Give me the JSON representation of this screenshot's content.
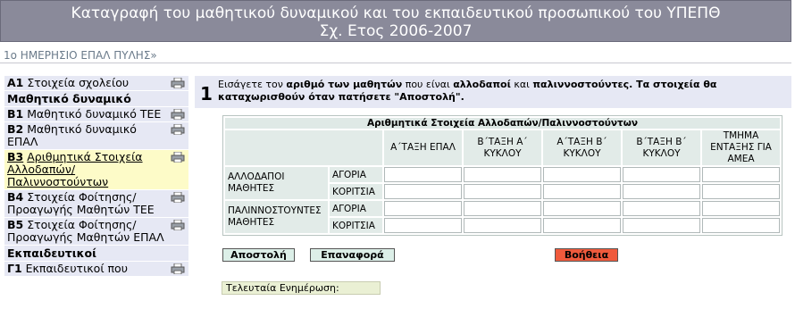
{
  "header": {
    "title_line1": "Καταγραφή του μαθητικού δυναμικού και του εκπαιδευτικού προσωπικού του ΥΠΕΠΘ",
    "title_line2": "Σχ. Ετος 2006-2007"
  },
  "school_name": "1ο ΗΜΕΡΗΣΙΟ ΕΠΑΛ ΠΥΛΗΣ»",
  "sidebar": {
    "items": [
      {
        "code": "A1",
        "label": "Στοιχεία σχολείου",
        "printer": true
      },
      {
        "heading": "Μαθητικό δυναμικό"
      },
      {
        "code": "B1",
        "label": "Μαθητικό δυναμικό ΤΕΕ",
        "printer": true
      },
      {
        "code": "B2",
        "label": "Μαθητικό δυναμικό ΕΠΑΛ",
        "printer": true
      },
      {
        "code": "B3",
        "label": "Αριθμητικά Στοιχεία Αλλοδαπών/ Παλιννοστούντων",
        "printer": true,
        "active": true
      },
      {
        "code": "B4",
        "label": "Στοιχεία Φοίτησης/Προαγωγής Μαθητών ΤΕΕ",
        "printer": true
      },
      {
        "code": "B5",
        "label": "Στοιχεία Φοίτησης/Προαγωγής Μαθητών ΕΠΑΛ",
        "printer": true
      },
      {
        "heading": "Εκπαιδευτικοί"
      },
      {
        "code": "Γ1",
        "label": "Εκπαιδευτικοί που",
        "printer": true
      }
    ]
  },
  "step": {
    "number": "1",
    "instr_p1": "Εισάγετε τον ",
    "instr_b1": "αριθμό των μαθητών",
    "instr_p2": " που είναι ",
    "instr_b2": "αλλοδαποί",
    "instr_p3": " και ",
    "instr_b3": "παλιννοστούντες. Τα στοιχεία θα καταχωρισθούν όταν πατήσετε \"Αποστολή\"."
  },
  "table": {
    "caption": "Αριθμητικά Στοιχεία Αλλοδαπών/Παλιννοστούντων",
    "columns": [
      "Α΄ΤΑΞΗ ΕΠΑΛ",
      "Β΄ΤΑΞΗ Α΄ ΚΥΚΛΟΥ",
      "Α΄ΤΑΞΗ Β΄ ΚΥΚΛΟΥ",
      "Β΄ΤΑΞΗ Β΄ ΚΥΚΛΟΥ",
      "ΤΜΗΜΑ ΕΝΤΑΞΗΣ ΓΙΑ ΑΜΕΑ"
    ],
    "groups": [
      {
        "label": "ΑΛΛΟΔΑΠΟΙ ΜΑΘΗΤΕΣ",
        "rows": [
          "ΑΓΟΡΙΑ",
          "ΚΟΡΙΤΣΙΑ"
        ]
      },
      {
        "label": "ΠΑΛΙΝΝΟΣΤΟΥΝΤΕΣ ΜΑΘΗΤΕΣ",
        "rows": [
          "ΑΓΟΡΙΑ",
          "ΚΟΡΙΤΣΙΑ"
        ]
      }
    ]
  },
  "buttons": {
    "send": "Αποστολή",
    "reset": "Επαναφορά",
    "help": "Βοήθεια"
  },
  "last_update_label": "Τελευταία Ενημέρωση:",
  "colors": {
    "header_bg": "#8a8a9a",
    "sidebar_bg": "#e6e8f4",
    "sidebar_active_bg": "#fdfbc8",
    "help_button": "#f05a3c"
  }
}
